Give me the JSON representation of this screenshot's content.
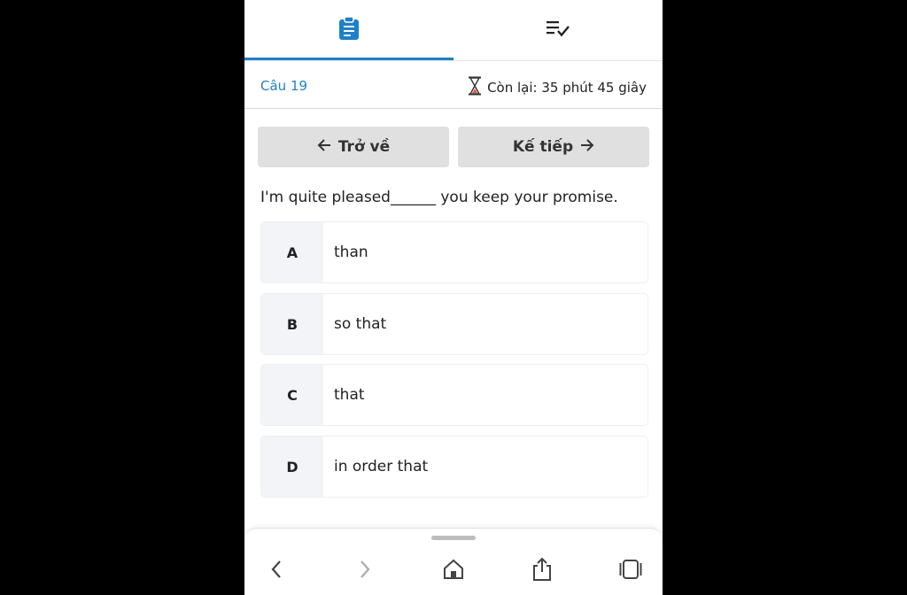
{
  "tabs": [
    {
      "name": "exam",
      "icon": "clipboard-icon",
      "active": true
    },
    {
      "name": "question-list",
      "icon": "list-check-icon",
      "active": false
    }
  ],
  "status": {
    "question_label": "Câu 19",
    "timer_icon": "hourglass-icon",
    "timer_text": "Còn lại: 35 phút 45 giây"
  },
  "nav": {
    "back_label": "Trở về",
    "next_label": "Kế tiếp"
  },
  "question": {
    "text": "I'm quite pleased______ you keep your promise."
  },
  "options": [
    {
      "letter": "A",
      "text": "than"
    },
    {
      "letter": "B",
      "text": "so that"
    },
    {
      "letter": "C",
      "text": "that"
    },
    {
      "letter": "D",
      "text": "in order that"
    }
  ],
  "browser_bar": {
    "buttons": [
      "back-arrow-icon",
      "forward-arrow-icon",
      "home-icon",
      "share-icon",
      "tabs-icon"
    ]
  },
  "colors": {
    "accent": "#1e7fc9",
    "button_bg": "#e0e0e0",
    "option_letter_bg": "#f2f4f7"
  }
}
